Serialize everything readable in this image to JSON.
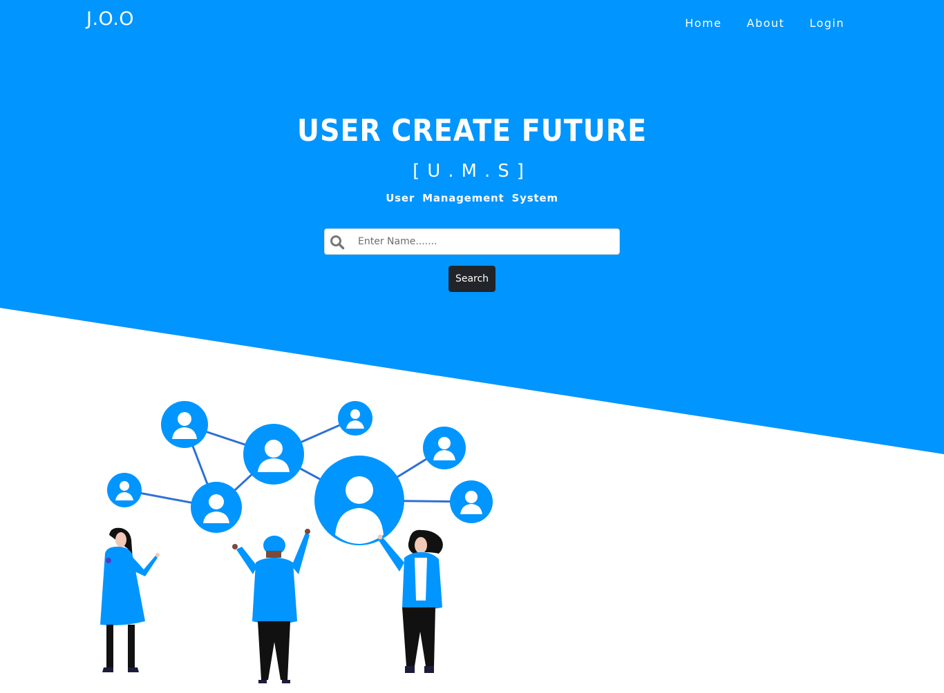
{
  "colors": {
    "primary": "#0095FF",
    "dark_button": "#212529",
    "white": "#FFFFFF",
    "network_line": "#2F6FD6",
    "skin": "#F2C8B6",
    "pants": "#111111",
    "hair": "#111111"
  },
  "navbar": {
    "brand": "J.O.O",
    "links": [
      {
        "label": "Home"
      },
      {
        "label": "About"
      },
      {
        "label": "Login"
      }
    ]
  },
  "hero": {
    "title": "USER CREATE FUTURE",
    "abbreviation": "[U.M.S]",
    "subtitle": "User Management System"
  },
  "search": {
    "icon": "search-icon",
    "placeholder": "Enter Name.......",
    "value": "",
    "button_label": "Search"
  },
  "illustration": {
    "description_icon": "user-network-illustration"
  }
}
